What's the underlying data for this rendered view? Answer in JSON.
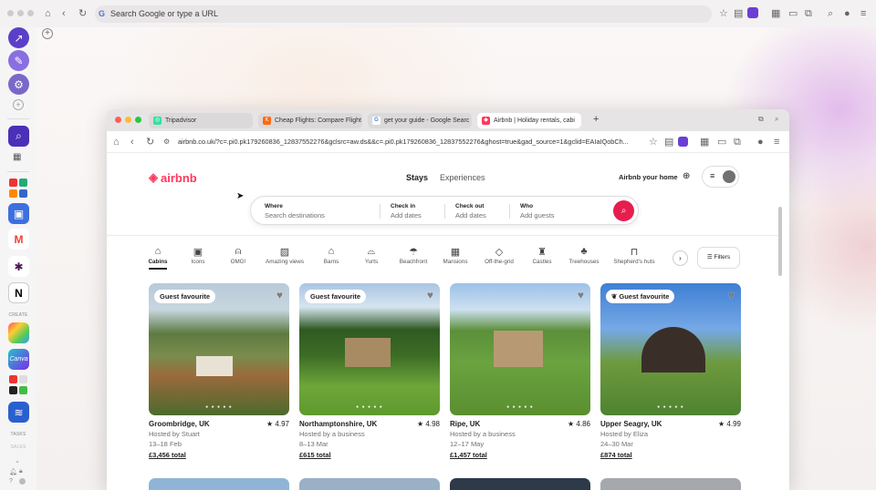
{
  "outer_browser": {
    "address_placeholder": "Search Google or type a URL"
  },
  "sidebar": {
    "labels": {
      "create": "CREATE",
      "tasks": "TASKS",
      "sales": "SALES"
    }
  },
  "inner_browser": {
    "tabs": [
      {
        "label": "Tripadvisor",
        "color": "#34e0a1"
      },
      {
        "label": "Cheap Flights: Compare Flight",
        "color": "#ff690f"
      },
      {
        "label": "get your guide - Google Searc",
        "color": "#4285f4"
      },
      {
        "label": "Airbnb | Holiday rentals, cabi",
        "color": "#ff385c"
      }
    ],
    "url": "airbnb.co.uk/?c=.pi0.pk179260836_12837552276&gclsrc=aw.ds&&c=.pi0.pk179260836_12837552276&ghost=true&gad_source=1&gclid=EAIaIQobCh..."
  },
  "airbnb": {
    "brand": "airbnb",
    "accent": "#ff385c",
    "nav": {
      "stays": "Stays",
      "experiences": "Experiences",
      "host": "Airbnb your home"
    },
    "search": {
      "where_label": "Where",
      "where_placeholder": "Search destinations",
      "checkin_label": "Check in",
      "checkin_value": "Add dates",
      "checkout_label": "Check out",
      "checkout_value": "Add dates",
      "who_label": "Who",
      "who_value": "Add guests"
    },
    "categories": [
      {
        "label": "Cabins",
        "icon": "cabin-icon"
      },
      {
        "label": "Icons",
        "icon": "icons-icon"
      },
      {
        "label": "OMG!",
        "icon": "ufo-icon"
      },
      {
        "label": "Amazing views",
        "icon": "views-icon"
      },
      {
        "label": "Barns",
        "icon": "barn-icon"
      },
      {
        "label": "Yurts",
        "icon": "yurt-icon"
      },
      {
        "label": "Beachfront",
        "icon": "beach-icon"
      },
      {
        "label": "Mansions",
        "icon": "mansion-icon"
      },
      {
        "label": "Off-the-grid",
        "icon": "grid-icon"
      },
      {
        "label": "Castles",
        "icon": "castle-icon"
      },
      {
        "label": "Treehouses",
        "icon": "treehouse-icon"
      },
      {
        "label": "Shepherd's huts",
        "icon": "hut-icon"
      }
    ],
    "filters_label": "Filters",
    "badge_text": "Guest favourite",
    "listings": [
      {
        "location": "Groombridge, UK",
        "rating": "4.97",
        "host": "Hosted by Stuart",
        "dates": "13–18 Feb",
        "price": "£3,456 total"
      },
      {
        "location": "Northamptonshire, UK",
        "rating": "4.98",
        "host": "Hosted by a business",
        "dates": "8–13 Mar",
        "price": "£615 total"
      },
      {
        "location": "Ripe, UK",
        "rating": "4.86",
        "host": "Hosted by a business",
        "dates": "12–17 May",
        "price": "£1,457 total"
      },
      {
        "location": "Upper Seagry, UK",
        "rating": "4.99",
        "host": "Hosted by Eliza",
        "dates": "24–30 Mar",
        "price": "£874 total"
      }
    ]
  }
}
